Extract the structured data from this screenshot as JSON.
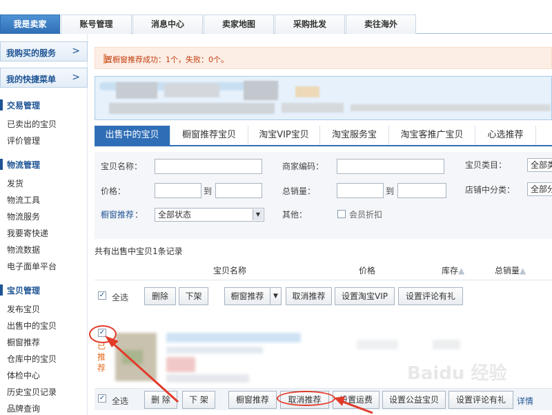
{
  "topnav": {
    "tabs": [
      {
        "label": "我是卖家"
      },
      {
        "label": "账号管理"
      },
      {
        "label": "消息中心"
      },
      {
        "label": "卖家地图"
      },
      {
        "label": "采购批发"
      },
      {
        "label": "卖往海外"
      }
    ]
  },
  "sidebar": {
    "box1": "我购买的服务",
    "box2": "我的快捷菜单",
    "arrow": ">",
    "sections": [
      {
        "title": "交易管理",
        "items": [
          "已卖出的宝贝",
          "评价管理"
        ]
      },
      {
        "title": "物流管理",
        "items": [
          "发货",
          "物流工具",
          "物流服务",
          "我要寄快递",
          "物流数据",
          "电子面单平台"
        ]
      },
      {
        "title": "宝贝管理",
        "items": [
          "发布宝贝",
          "出售中的宝贝",
          "橱窗推荐",
          "仓库中的宝贝",
          "体检中心",
          "历史宝贝记录",
          "品牌查询"
        ]
      }
    ]
  },
  "alert": {
    "text": "置橱窗推荐成功：1个，失败：0个。"
  },
  "tabs": [
    "出售中的宝贝",
    "橱窗推荐宝贝",
    "淘宝VIP宝贝",
    "淘宝服务宝",
    "淘宝客推广宝贝",
    "心选推荐"
  ],
  "form": {
    "name_label": "宝贝名称：",
    "code_label": "商家编码：",
    "category_label": "宝贝类目：",
    "category_value": "全部类",
    "price_label": "价格：",
    "to": "到",
    "sales_label": "总销量：",
    "shopcat_label": "店铺中分类：",
    "shopcat_value": "全部分",
    "window_label": "橱窗推荐",
    "colon": "：",
    "status_value": "全部状态",
    "other_label": "其他：",
    "member_discount": "会员折扣"
  },
  "record": "共有出售中宝贝1条记录",
  "table": {
    "col_name": "宝贝名称",
    "col_price": "价格",
    "col_stock": "库存",
    "col_sales": "总销量"
  },
  "toolbar": {
    "select_all": "全选",
    "delete": "删除",
    "offshelf": "下架",
    "window_rec": "橱窗推荐",
    "cancel_rec": "取消推荐",
    "set_vip": "设置淘宝VIP",
    "set_review": "设置评论有礼"
  },
  "item": {
    "status": [
      "已",
      "推",
      "荐"
    ],
    "check": "✓"
  },
  "bottombar": {
    "select_all": "全选",
    "delete": "删 除",
    "offshelf": "下 架",
    "window_rec": "橱窗推荐",
    "cancel_rec": "取消推荐",
    "set_shipping": "设置运费",
    "set_charity": "设置公益宝贝",
    "set_review": "设置评论有礼",
    "details": "详情"
  },
  "watermark": "Baidu 经验",
  "colors": {
    "accent": "#2f6eb6",
    "alert_text": "#c13c0c",
    "annotation": "#e23a2a"
  }
}
